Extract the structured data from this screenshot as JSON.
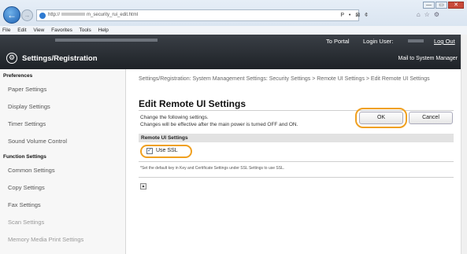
{
  "browser": {
    "url_prefix": "http://",
    "url_suffix": "m_security_rui_edit.html",
    "tools": "P • ⊠ ¢",
    "window_controls": [
      "—",
      "▭",
      "✕"
    ],
    "menu": [
      "File",
      "Edit",
      "View",
      "Favorites",
      "Tools",
      "Help"
    ]
  },
  "header": {
    "title": "Settings/Registration",
    "to_portal": "To Portal",
    "login_user_label": "Login User:",
    "logout": "Log Out",
    "mail_to_manager": "Mail to System Manager"
  },
  "sidebar": {
    "sections": [
      {
        "heading": "Preferences",
        "items": [
          "Paper Settings",
          "Display Settings",
          "Timer Settings",
          "Sound Volume Control"
        ]
      },
      {
        "heading": "Function Settings",
        "items": [
          "Common Settings",
          "Copy Settings",
          "Fax Settings",
          "Scan Settings",
          "Memory Media Print Settings"
        ]
      }
    ]
  },
  "main": {
    "breadcrumb": "Settings/Registration: System Management Settings: Security Settings > Remote UI Settings > Edit Remote UI Settings",
    "title": "Edit Remote UI Settings",
    "instruction1": "Change the following settings.",
    "instruction2": "Changes will be effective after the main power is turned OFF and ON.",
    "ok_label": "OK",
    "cancel_label": "Cancel",
    "section_heading": "Remote UI Settings",
    "ssl_label": "Use SSL",
    "ssl_checked": true,
    "note": "*Set the default key in Key and Certificate Settings under SSL Settings to use SSL.",
    "top_glyph": "▲"
  }
}
